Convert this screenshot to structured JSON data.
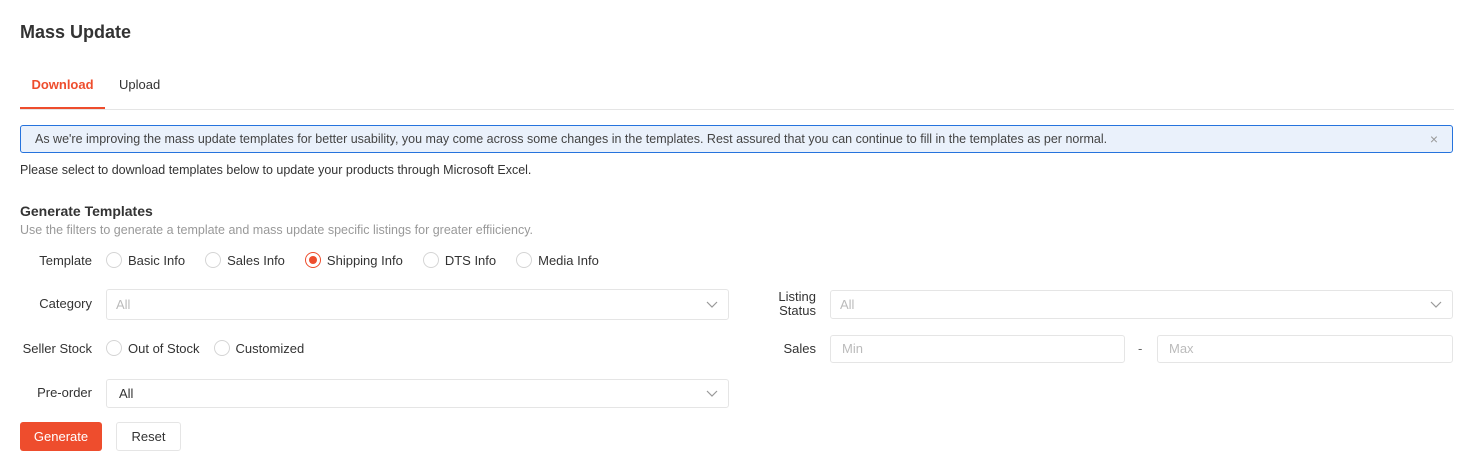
{
  "page": {
    "title": "Mass Update"
  },
  "tabs": [
    {
      "label": "Download"
    },
    {
      "label": "Upload"
    }
  ],
  "notice": {
    "text": "As we're improving the mass update templates for better usability, you may come across some changes in the templates. Rest assured that you can continue to fill in the templates as per normal.",
    "close_icon": "×"
  },
  "description": "Please select to download templates below to update your products through Microsoft Excel.",
  "generate": {
    "title": "Generate Templates",
    "subtitle": "Use the filters to generate a template and mass update specific listings for greater effiiciency."
  },
  "template": {
    "label": "Template",
    "options": [
      "Basic Info",
      "Sales Info",
      "Shipping Info",
      "DTS Info",
      "Media Info"
    ],
    "selected": "Shipping Info"
  },
  "category": {
    "label": "Category",
    "value": "All"
  },
  "listing_status": {
    "label_line1": "Listing",
    "label_line2": "Status",
    "value": "All"
  },
  "seller_stock": {
    "label": "Seller Stock",
    "options": [
      "Out of Stock",
      "Customized"
    ]
  },
  "sales": {
    "label": "Sales",
    "min_placeholder": "Min",
    "max_placeholder": "Max",
    "separator": "-"
  },
  "preorder": {
    "label": "Pre-order",
    "value": "All"
  },
  "buttons": {
    "generate": "Generate",
    "reset": "Reset"
  },
  "colors": {
    "accent": "#ee4d2d",
    "notice_border": "#2673dd",
    "notice_bg": "#eaf1fb"
  },
  "icons": {
    "chevron": "chevron-down-icon",
    "close": "close-icon"
  }
}
